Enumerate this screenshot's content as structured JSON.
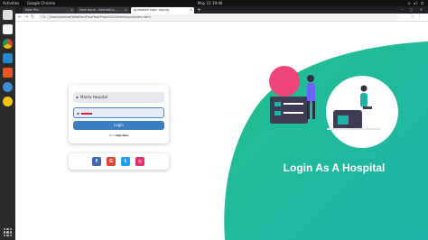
{
  "os": {
    "activities": "Activities",
    "app_name": "Google Chrome",
    "clock": "May 21  19:46",
    "tray": "⊙ ◂) ⏻"
  },
  "browser": {
    "tabs": [
      {
        "label": "New File"
      },
      {
        "label": "New Issue · Akshat/Lo..."
      },
      {
        "label": "Animated login signup"
      }
    ],
    "new_tab": "+",
    "window_controls": "–  ▢  ✕",
    "address": {
      "scheme": "File  |  ",
      "path": "/home/akshat/WebDev/FinalYearProject%20Hall/login/index.html"
    }
  },
  "login_form": {
    "username_value": "Manta Hospital",
    "login_label": "Login",
    "signup_prompt": "Don't",
    "signup_link": "Sign Here"
  },
  "social": {
    "buttons": [
      {
        "icon": "facebook-icon",
        "glyph": "f",
        "color": "#4267b2"
      },
      {
        "icon": "google-icon",
        "glyph": "G",
        "color": "#db4437"
      },
      {
        "icon": "twitter-icon",
        "glyph": "t",
        "color": "#1da1f2"
      },
      {
        "icon": "instagram-icon",
        "glyph": "◎",
        "color": "#e1306c"
      }
    ]
  },
  "hero": {
    "title": "Login As A Hospital"
  },
  "colors": {
    "accent_green": "#1ebf93",
    "accent_teal": "#22b5a4",
    "button_blue": "#3a7fc4",
    "pink_circle": "#f0457a"
  }
}
